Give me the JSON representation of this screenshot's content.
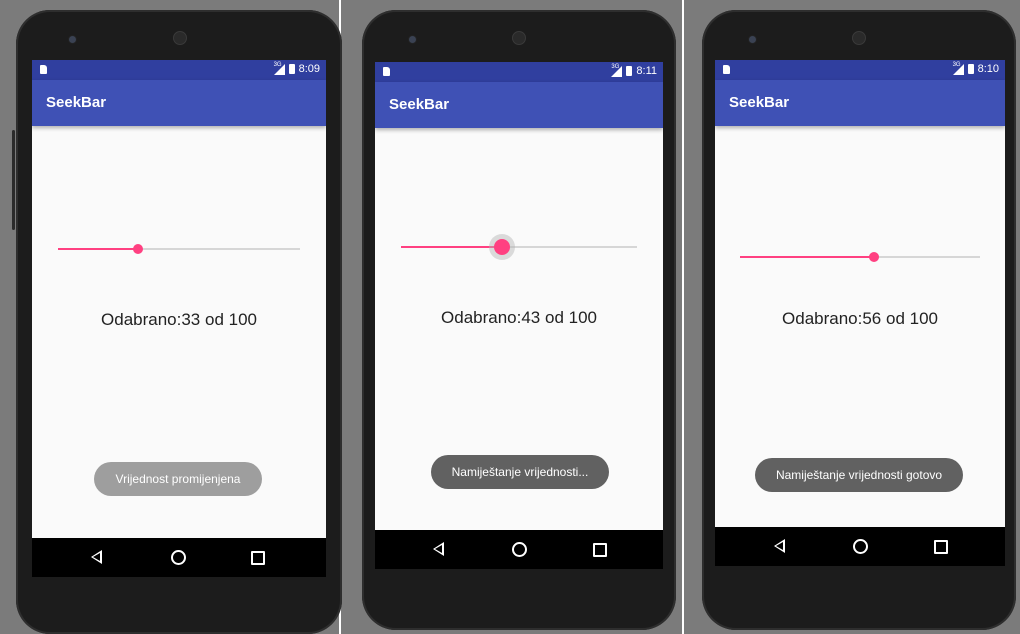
{
  "screens": [
    {
      "status": {
        "time": "8:09",
        "network": "3G"
      },
      "app_title": "SeekBar",
      "seekbar": {
        "value": 33,
        "max": 100
      },
      "label": "Odabrano:33 od 100",
      "toast": {
        "text": "Vrijednost promijenjena",
        "color": "#9e9e9e"
      }
    },
    {
      "status": {
        "time": "8:11",
        "network": "3G"
      },
      "app_title": "SeekBar",
      "seekbar": {
        "value": 43,
        "max": 100,
        "pressed": true
      },
      "label": "Odabrano:43 od 100",
      "toast": {
        "text": "Namiještanje vrijednosti...",
        "color": "#616161"
      }
    },
    {
      "status": {
        "time": "8:10",
        "network": "3G"
      },
      "app_title": "SeekBar",
      "seekbar": {
        "value": 56,
        "max": 100
      },
      "label": "Odabrano:56 od 100",
      "toast": {
        "text": "Namiještanje vrijednosti gotovo",
        "color": "#616161"
      }
    }
  ],
  "colors": {
    "appbar": "#3f51b5",
    "statusbar": "#303f9f",
    "accent": "#ff4081"
  },
  "icons": [
    "sd-card-icon",
    "signal-icon",
    "battery-icon",
    "nav-back-icon",
    "nav-home-icon",
    "nav-recents-icon"
  ]
}
